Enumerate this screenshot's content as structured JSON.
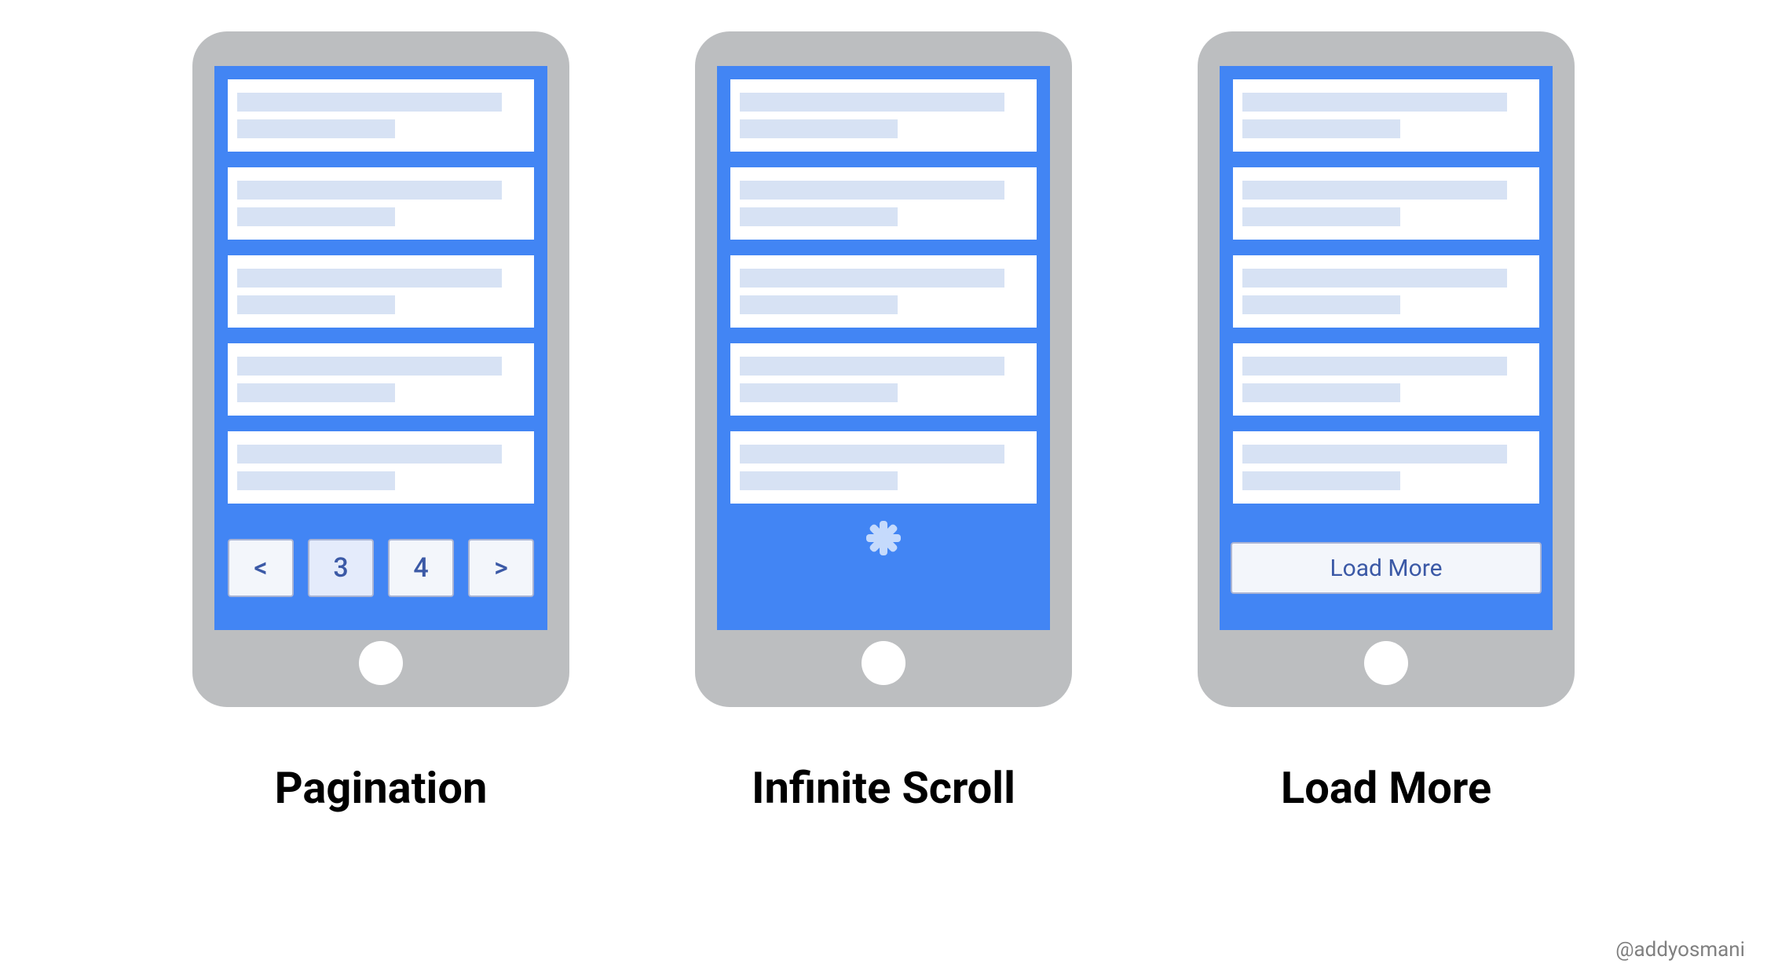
{
  "credit": "@addyosmani",
  "phones": [
    {
      "caption": "Pagination",
      "pager": {
        "prev": "<",
        "p1": "3",
        "p2": "4",
        "next": ">"
      }
    },
    {
      "caption": "Infinite Scroll"
    },
    {
      "caption": "Load More",
      "button_label": "Load More"
    }
  ]
}
